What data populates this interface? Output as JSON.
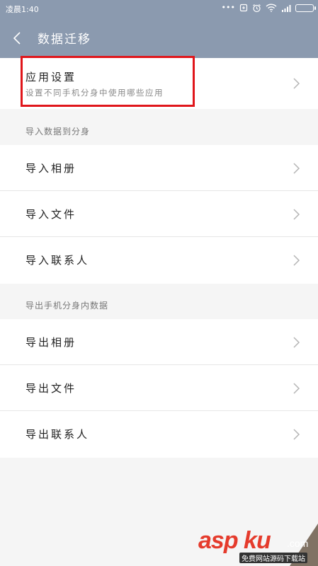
{
  "status_bar": {
    "time": "凌晨1:40",
    "icons": [
      "more-dots-icon",
      "sync-icon",
      "alarm-icon",
      "wifi-icon",
      "signal-icon",
      "battery-icon"
    ]
  },
  "header": {
    "back_icon": "chevron-left-icon",
    "title": "数据迁移"
  },
  "app_settings": {
    "title": "应用设置",
    "subtitle": "设置不同手机分身中使用哪些应用"
  },
  "import_section": {
    "label": "导入数据到分身",
    "items": [
      {
        "label": "导入相册"
      },
      {
        "label": "导入文件"
      },
      {
        "label": "导入联系人"
      }
    ]
  },
  "export_section": {
    "label": "导出手机分身内数据",
    "items": [
      {
        "label": "导出相册"
      },
      {
        "label": "导出文件"
      },
      {
        "label": "导出联系人"
      }
    ]
  },
  "watermark": {
    "brand": "asp ku",
    "domain": ".com",
    "tagline": "免费网站源码下载站"
  },
  "colors": {
    "header_bg": "#8b9aaf",
    "highlight": "#e0161b",
    "page_bg": "#f5f5f5"
  }
}
